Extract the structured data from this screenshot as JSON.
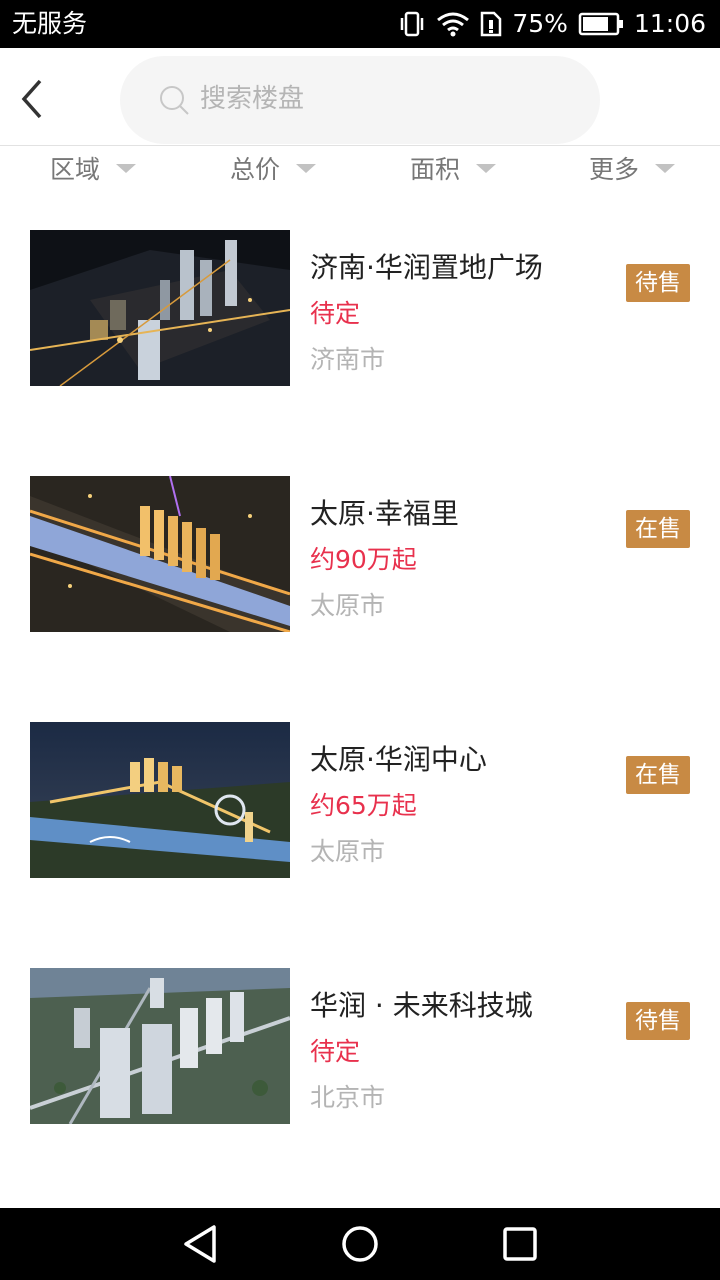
{
  "status_bar": {
    "carrier": "无服务",
    "battery": "75%",
    "time": "11:06"
  },
  "search": {
    "placeholder": "搜索楼盘",
    "value": ""
  },
  "filters": [
    {
      "label": "区域"
    },
    {
      "label": "总价"
    },
    {
      "label": "面积"
    },
    {
      "label": "更多"
    }
  ],
  "properties": [
    {
      "name": "济南·华润置地广场",
      "price": "待定",
      "city": "济南市",
      "status": "待售"
    },
    {
      "name": "太原·幸福里",
      "price": "约90万起",
      "city": "太原市",
      "status": "在售"
    },
    {
      "name": "太原·华润中心",
      "price": "约65万起",
      "city": "太原市",
      "status": "在售"
    },
    {
      "name": "华润 · 未来科技城",
      "price": "待定",
      "city": "北京市",
      "status": "待售"
    }
  ],
  "colors": {
    "badge": "#c88a44",
    "price": "#e8314d"
  }
}
